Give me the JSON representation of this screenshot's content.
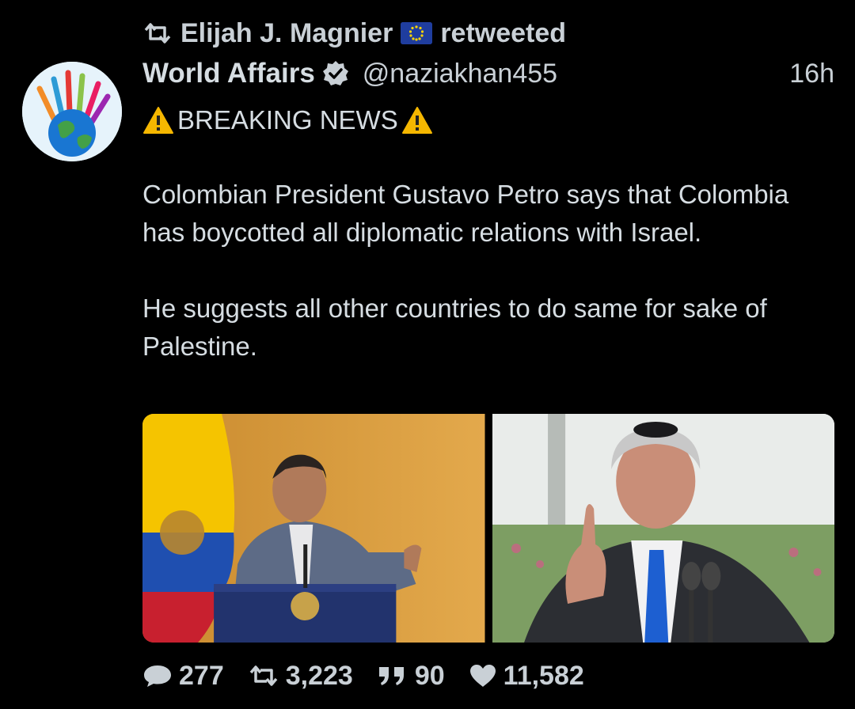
{
  "retweet": {
    "icon": "retweet-icon",
    "user": "Elijah J. Magnier",
    "flag_icon": "eu-flag-icon",
    "label": "retweeted"
  },
  "tweet": {
    "avatar_icon": "hands-globe-avatar",
    "display_name": "World Affairs",
    "verified_icon": "verified-badge-icon",
    "handle": "@naziakhan455",
    "time": "16h",
    "breaking": "BREAKING NEWS",
    "paragraph1": "Colombian President  Gustavo Petro says that Colombia has boycotted all diplomatic relations with Israel.",
    "paragraph2": "He suggests all other countries to do same for sake of Palestine."
  },
  "media": {
    "left_photo": "Gustavo Petro speaking at podium",
    "right_photo": "Benjamin Netanyahu speaking"
  },
  "actions": {
    "replies": "277",
    "retweets": "3,223",
    "quotes": "90",
    "likes": "11,582"
  },
  "colors": {
    "background": "#000000",
    "text": "#d6dde2",
    "verified_badge": "#c9d0d6",
    "warning": "#f5b700"
  }
}
